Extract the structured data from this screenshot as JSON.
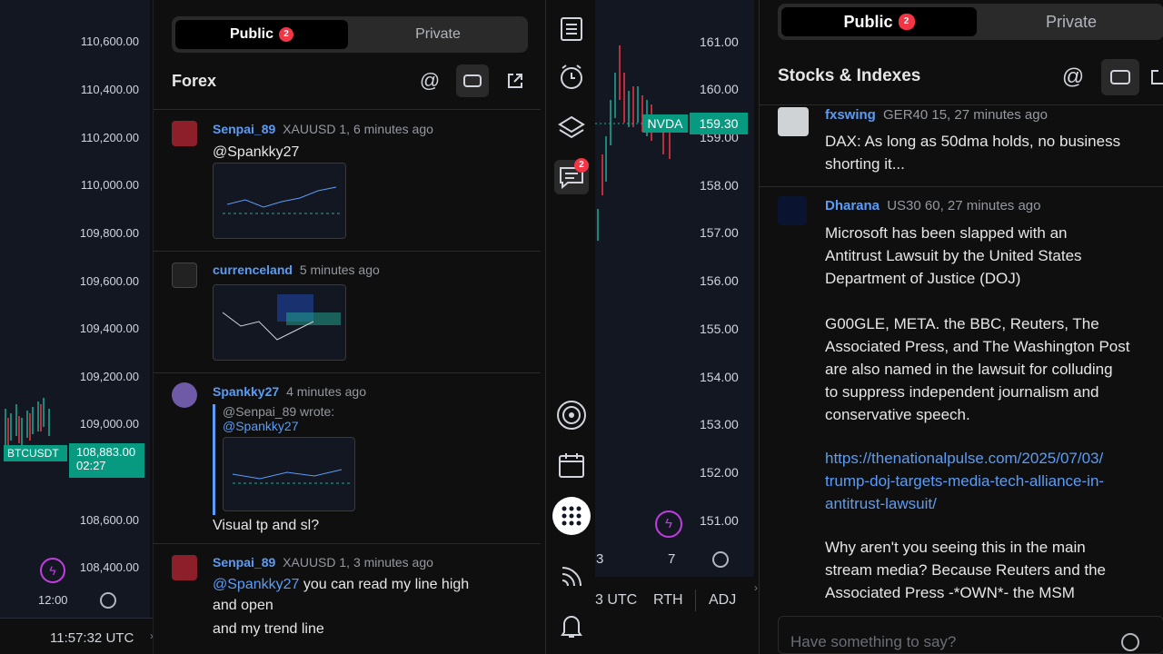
{
  "left_chart": {
    "prices": [
      "110,600.00",
      "110,400.00",
      "110,200.00",
      "110,000.00",
      "109,800.00",
      "109,600.00",
      "109,400.00",
      "109,200.00",
      "109,000.00",
      "108,600.00",
      "108,400.00"
    ],
    "symbol_tag": "BTCUSDT",
    "last_price": "108,883.00",
    "countdown": "02:27",
    "time_label": "12:00",
    "clock": "11:57:32 UTC"
  },
  "forex": {
    "tab_public": "Public",
    "tab_public_badge": "2",
    "tab_private": "Private",
    "title": "Forex",
    "messages": [
      {
        "user": "Senpai_89",
        "meta": "XAUUSD 1, 6 minutes ago",
        "mention": "@Spankky27",
        "text": ""
      },
      {
        "user": "currenceland",
        "meta": "5 minutes ago"
      },
      {
        "user": "Spankky27",
        "meta": "4 minutes ago",
        "quote_line1": "@Senpai_89 wrote:",
        "quote_line2": "@Spankky27",
        "text": "Visual tp and sl?"
      },
      {
        "user": "Senpai_89",
        "meta": "XAUUSD 1, 3 minutes ago",
        "mention": "@Spankky27",
        "text": " you can read my line high",
        "text2": "and open",
        "text3": "and my trend line"
      }
    ]
  },
  "toolbar": {
    "chat_badge": "2",
    "icons": [
      "watchlist-icon",
      "alert-clock-icon",
      "layers-icon",
      "chat-icon",
      "target-icon",
      "calendar-icon",
      "apps-grid-icon",
      "stream-icon",
      "bell-icon"
    ]
  },
  "mid_chart": {
    "prices": [
      "161.00",
      "160.00",
      "159.00",
      "158.00",
      "157.00",
      "156.00",
      "155.00",
      "154.00",
      "153.00",
      "152.00",
      "151.00"
    ],
    "symbol_tag": "NVDA",
    "last_price": "159.30",
    "x_labels": [
      "3",
      "7"
    ],
    "utc": "3 UTC",
    "rth": "RTH",
    "adj": "ADJ"
  },
  "stocks": {
    "tab_public": "Public",
    "tab_public_badge": "2",
    "tab_private": "Private",
    "title": "Stocks & Indexes",
    "messages": [
      {
        "user": "fxswing",
        "meta": "GER40 15, 27 minutes ago",
        "text": "DAX: As long as 50dma holds, no business\nshorting it..."
      },
      {
        "user": "Dharana",
        "meta": "US30 60, 27 minutes ago",
        "p1": "Microsoft has been slapped with an\nAntitrust Lawsuit by the United States\nDepartment of Justice (DOJ)",
        "p2": "G00GLE, META. the BBC, Reuters, The\nAssociated Press, and The Washington Post\nare also named in the lawsuit for colluding\nto suppress independent journalism and\nconservative speech.",
        "link": "https://thenationalpulse.com/2025/07/03/\ntrump-doj-targets-media-tech-alliance-in-\nantitrust-lawsuit/",
        "p3": "Why aren't you seeing this in the main\nstream media? Because Reuters and the\nAssociated Press -*OWN*- the MSM"
      }
    ],
    "input_placeholder": "Have something to say?"
  },
  "colors": {
    "accent": "#5b9cf6",
    "badge": "#f23645",
    "green": "#22ab94",
    "tag_green": "#089981"
  }
}
